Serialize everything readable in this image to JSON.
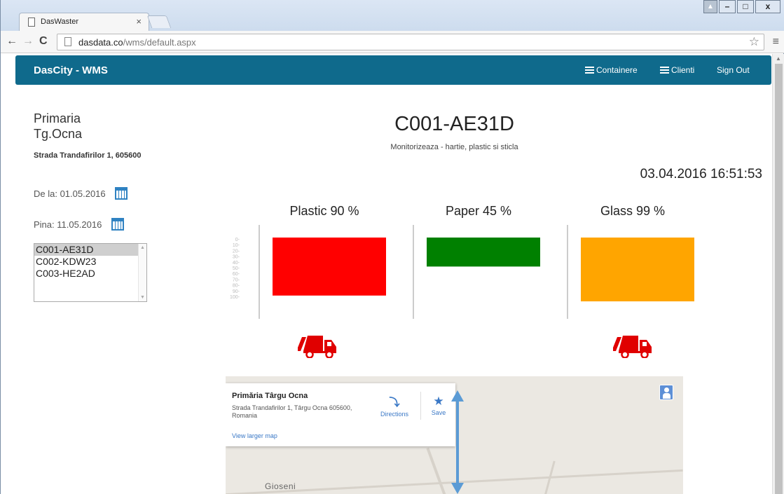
{
  "browser": {
    "tab_title": "DasWaster",
    "tab_close": "×",
    "url_host": "dasdata.co",
    "url_path": "/wms/default.aspx",
    "controls": {
      "minimize": "–",
      "maximize": "□",
      "close": "x"
    }
  },
  "navbar": {
    "brand": "DasCity - WMS",
    "links": {
      "containere": "Containere",
      "clienti": "Clienti",
      "sign_out": "Sign Out"
    },
    "color": "#0f6a8c"
  },
  "client": {
    "name": "Primaria Tg.Ocna",
    "address": "Strada Trandafirilor 1, 605600",
    "date_from": "De la: 01.05.2016",
    "date_to": "Pina: 11.05.2016"
  },
  "devices": {
    "items": [
      "C001-AE31D",
      "C002-KDW23",
      "C003-HE2AD"
    ],
    "selected": "C001-AE31D"
  },
  "device": {
    "id": "C001-AE31D",
    "subtitle": "Monitorizeaza - hartie, plastic si sticla",
    "timestamp": "03.04.2016 16:51:53"
  },
  "chart_data": {
    "type": "bar",
    "categories": [
      "Plastic 90 %",
      "Paper 45 %",
      "Glass 99 %"
    ],
    "values": [
      90,
      45,
      99
    ],
    "colors": [
      "#ff0000",
      "#008000",
      "#ffa500"
    ],
    "y_ticks": [
      0,
      10,
      20,
      30,
      40,
      50,
      60,
      70,
      80,
      90,
      100
    ],
    "ylim": [
      0,
      100
    ],
    "truck_alert": [
      true,
      false,
      true
    ]
  },
  "map": {
    "place": "Primăria Târgu Ocna",
    "address": "Strada Trandafirilor 1, Târgu Ocna 605600, Romania",
    "view_larger": "View larger map",
    "directions": "Directions",
    "save": "Save",
    "town": "Gioseni"
  },
  "icons": {
    "truck": "garbage-truck-icon",
    "calendar": "calendar-icon",
    "truck_color": "#e00000"
  }
}
